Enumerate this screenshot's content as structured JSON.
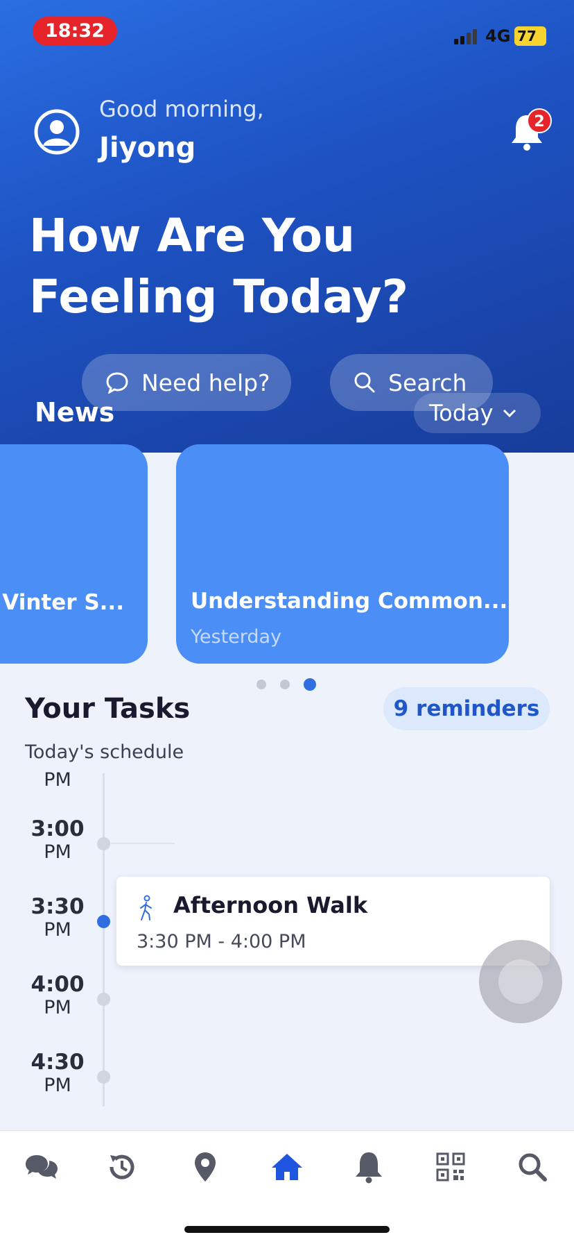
{
  "status_bar": {
    "time": "18:32",
    "network": "4G",
    "battery": "77"
  },
  "header": {
    "greeting": "Good morning,",
    "user_name": "Jiyong",
    "notification_count": "2",
    "headline": "How Are You Feeling Today?",
    "help_label": "Need help?",
    "search_label": "Search"
  },
  "news": {
    "title": "News",
    "filter_label": "Today",
    "cards": [
      {
        "title": "Vinter S...",
        "date": ""
      },
      {
        "title": "Understanding Common...",
        "date": "Yesterday"
      }
    ],
    "active_page": 3,
    "page_count": 3
  },
  "tasks": {
    "title": "Your Tasks",
    "reminders_label": "9 reminders",
    "subtitle": "Today's schedule",
    "times": [
      {
        "hm": "",
        "ap": "PM"
      },
      {
        "hm": "3:00",
        "ap": "PM"
      },
      {
        "hm": "3:30",
        "ap": "PM"
      },
      {
        "hm": "4:00",
        "ap": "PM"
      },
      {
        "hm": "4:30",
        "ap": "PM"
      }
    ],
    "event": {
      "title": "Afternoon Walk",
      "time_range": "3:30 PM - 4:00 PM",
      "icon": "walking-person-icon"
    }
  },
  "bottom_nav": {
    "items": [
      {
        "icon": "chat-bubbles-icon"
      },
      {
        "icon": "history-icon"
      },
      {
        "icon": "location-pin-icon"
      },
      {
        "icon": "home-icon",
        "active": true
      },
      {
        "icon": "bell-icon"
      },
      {
        "icon": "qr-code-icon"
      },
      {
        "icon": "search-icon"
      }
    ]
  },
  "colors": {
    "accent": "#2f6de0",
    "header_top": "#2a6ee2",
    "header_bottom": "#173c9a",
    "card": "#4b8ef5",
    "badge_red": "#e5252a",
    "nav_active": "#1f56e0",
    "nav_inactive": "#555a66"
  }
}
